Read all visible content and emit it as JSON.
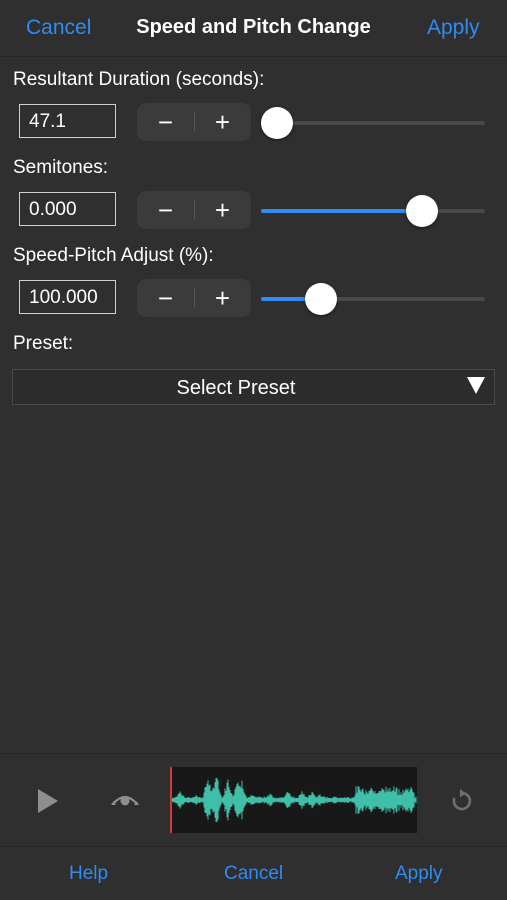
{
  "nav": {
    "cancel": "Cancel",
    "title": "Speed and Pitch Change",
    "apply": "Apply"
  },
  "duration": {
    "label": "Resultant Duration (seconds):",
    "value": "47.1",
    "slider_fraction": 0.07
  },
  "semitones": {
    "label": "Semitones:",
    "value": "0.000",
    "slider_fraction": 0.72
  },
  "speed_pitch": {
    "label": "Speed-Pitch Adjust (%):",
    "value": "100.000",
    "slider_fraction": 0.27
  },
  "stepper": {
    "minus": "−",
    "plus": "+"
  },
  "preset": {
    "label": "Preset:",
    "select_label": "Select Preset"
  },
  "player": {
    "play_icon": "play-icon",
    "scrub_icon": "scrub-icon",
    "reset_icon": "reset-icon",
    "waveform_color": "#3fbfa8"
  },
  "toolbar": {
    "help": "Help",
    "cancel": "Cancel",
    "apply": "Apply"
  },
  "colors": {
    "accent": "#2f8cf2",
    "background": "#2f2f2f"
  }
}
